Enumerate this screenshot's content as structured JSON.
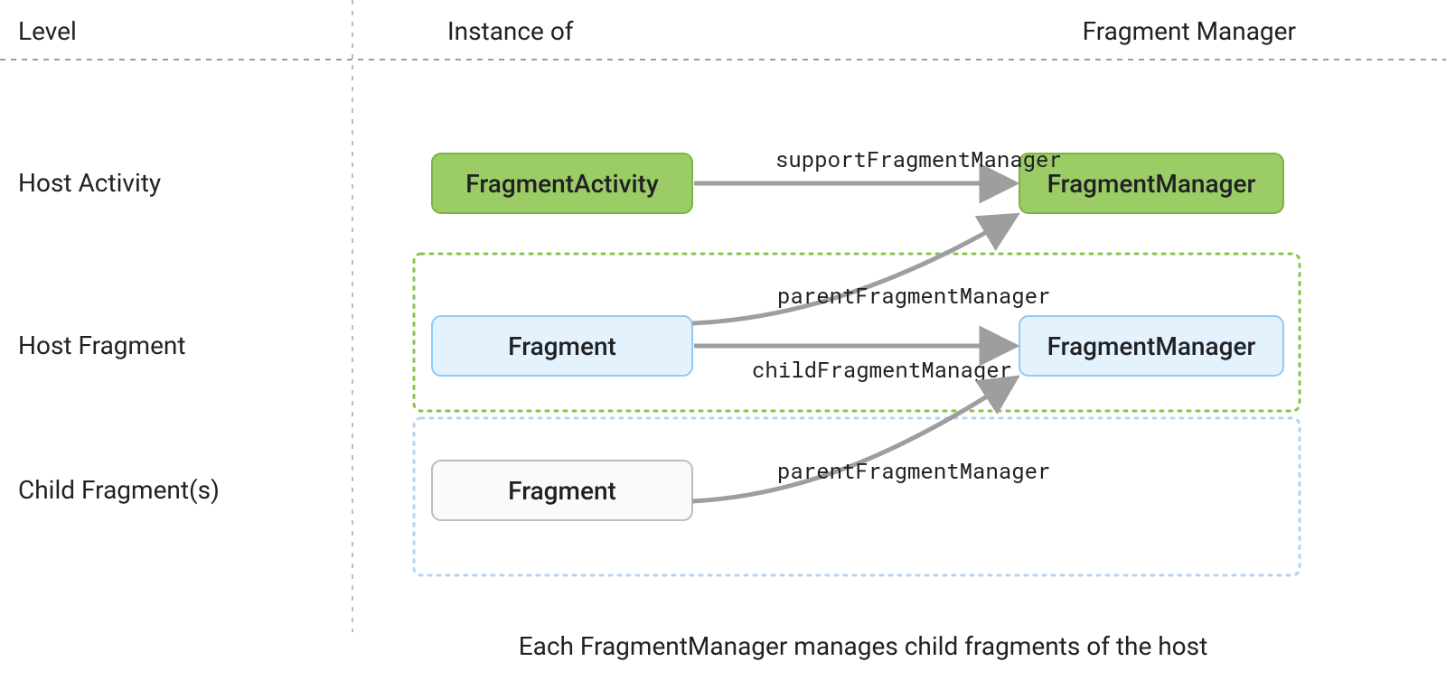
{
  "headers": {
    "level": "Level",
    "instance_of": "Instance of",
    "fragment_manager": "Fragment Manager"
  },
  "rows": {
    "host_activity": "Host Activity",
    "host_fragment": "Host Fragment",
    "child_fragments": "Child Fragment(s)"
  },
  "nodes": {
    "fragment_activity": "FragmentActivity",
    "fragment_host": "Fragment",
    "fragment_child": "Fragment",
    "fm_activity": "FragmentManager",
    "fm_host": "FragmentManager"
  },
  "edges": {
    "support_fm": "supportFragmentManager",
    "parent_fm_host": "parentFragmentManager",
    "child_fm": "childFragmentManager",
    "parent_fm_child": "parentFragmentManager"
  },
  "caption": "Each FragmentManager manages child fragments of the host",
  "colors": {
    "green_fill": "#9ccc65",
    "green_stroke": "#7cb342",
    "blue_fill": "#e3f2fd",
    "blue_stroke": "#90caf9",
    "gray_fill": "#fafafa",
    "gray_stroke": "#bdbdbd",
    "dash_green": "#8bc34a",
    "dash_blue": "#b3d4f5",
    "header_dash": "#9e9e9e",
    "vert_dash": "#bdbdbd",
    "arrow": "#9e9e9e"
  }
}
